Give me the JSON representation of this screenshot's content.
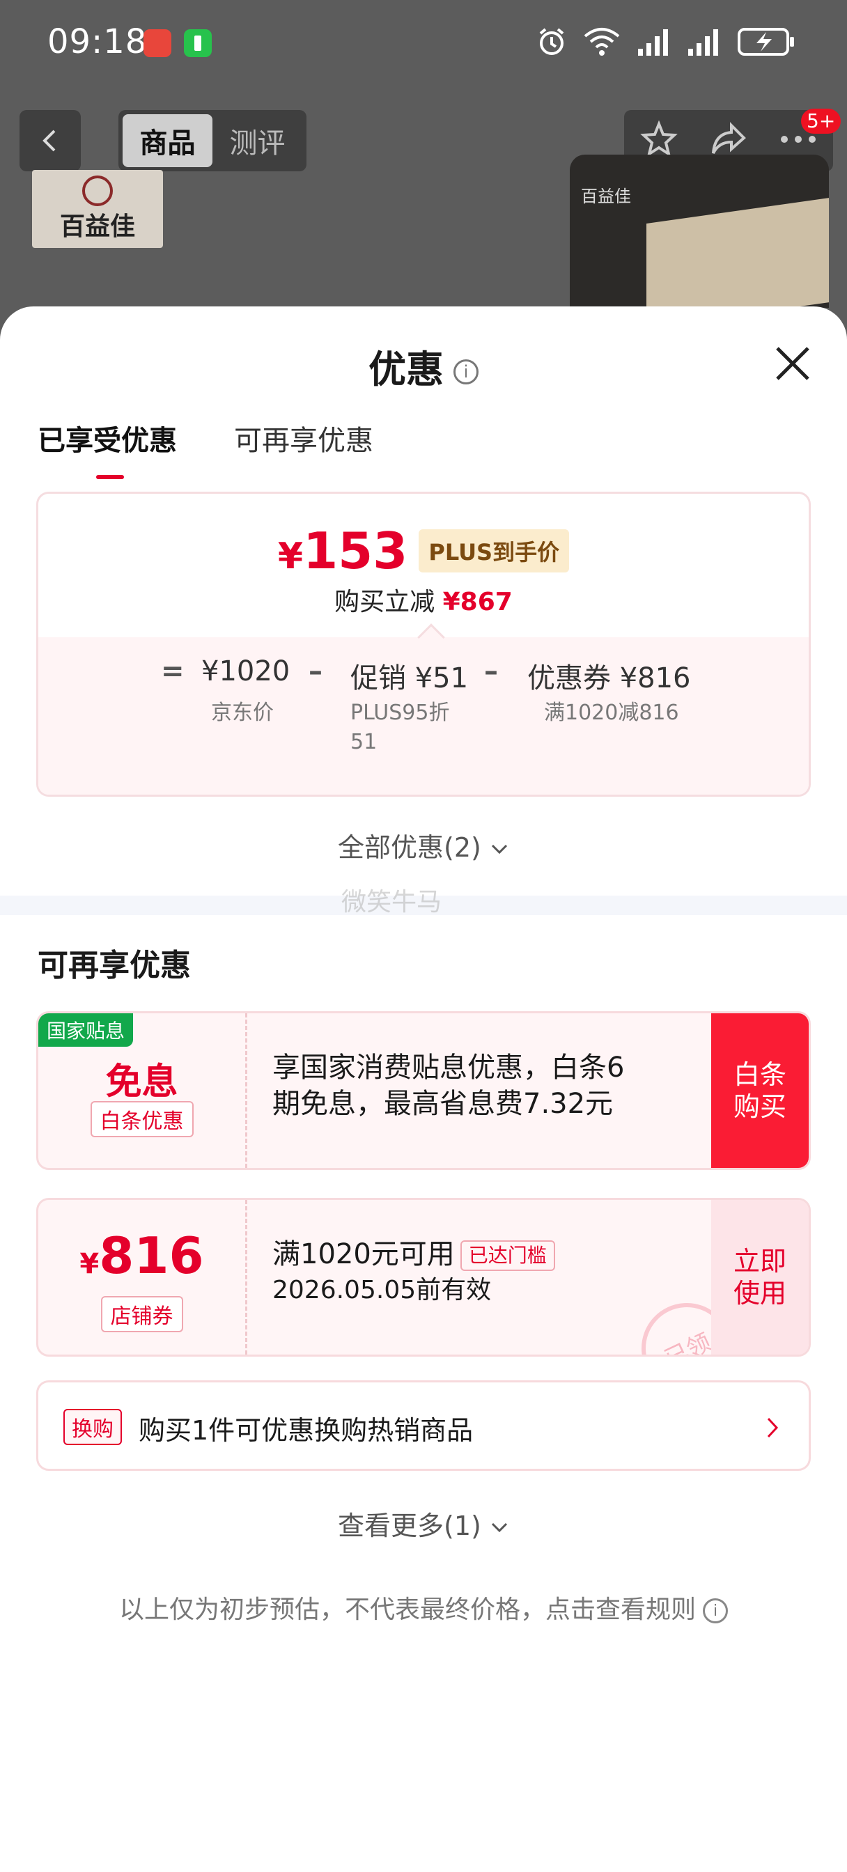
{
  "status_bar": {
    "time": "09:18",
    "icons": [
      "huawei-app-icon",
      "battery-app-icon",
      "alarm-icon",
      "wifi-icon",
      "signal-icon",
      "signal-icon",
      "battery-charging-icon"
    ]
  },
  "background_page": {
    "nav_tabs": [
      "商品",
      "测评"
    ],
    "badge": "5+",
    "brand_logo_text": "百益佳",
    "thumb_text": "百益佳"
  },
  "sheet": {
    "title": "优惠",
    "tabs": [
      "已享受优惠",
      "可再享优惠"
    ],
    "summary": {
      "yen": "¥",
      "price": "153",
      "price_tag": "PLUS到手价",
      "reduce_label": "购买立减",
      "reduce_amount": "¥867",
      "equals": "=",
      "minus": "–",
      "jd_price": "¥1020",
      "jd_label": "京东价",
      "promo_price": "促销 ¥51",
      "promo_desc_1": "PLUS95折",
      "promo_desc_2": "51",
      "coupon_price": "优惠券 ¥816",
      "coupon_desc": "满1020减816"
    },
    "all_offers": "全部优惠(2)",
    "watermark": "微笑牛马",
    "section_title": "可再享优惠",
    "offer1": {
      "badge": "国家贴息",
      "main": "免息",
      "sub": "白条优惠",
      "text_line1": "享国家消费贴息优惠，白条6",
      "text_line2": "期免息，最高省息费7.32元",
      "action_line1": "白条",
      "action_line2": "购买"
    },
    "offer2": {
      "yen": "¥",
      "main": "816",
      "sub": "店铺券",
      "text_line1": "满1020元可用",
      "threshold": "已达门槛",
      "text_line2": "2026.05.05前有效",
      "action_line1": "立即",
      "action_line2": "使用",
      "stamp": "已领"
    },
    "swap": {
      "tag": "换购",
      "text": "购买1件可优惠换购热销商品"
    },
    "see_more": "查看更多(1)",
    "disclaimer": "以上仅为初步预估，不代表最终价格，点击查看规则"
  },
  "colors": {
    "accent_red": "#e4002b",
    "green_badge": "#12a84b",
    "overlay": "#5c5c5c"
  }
}
